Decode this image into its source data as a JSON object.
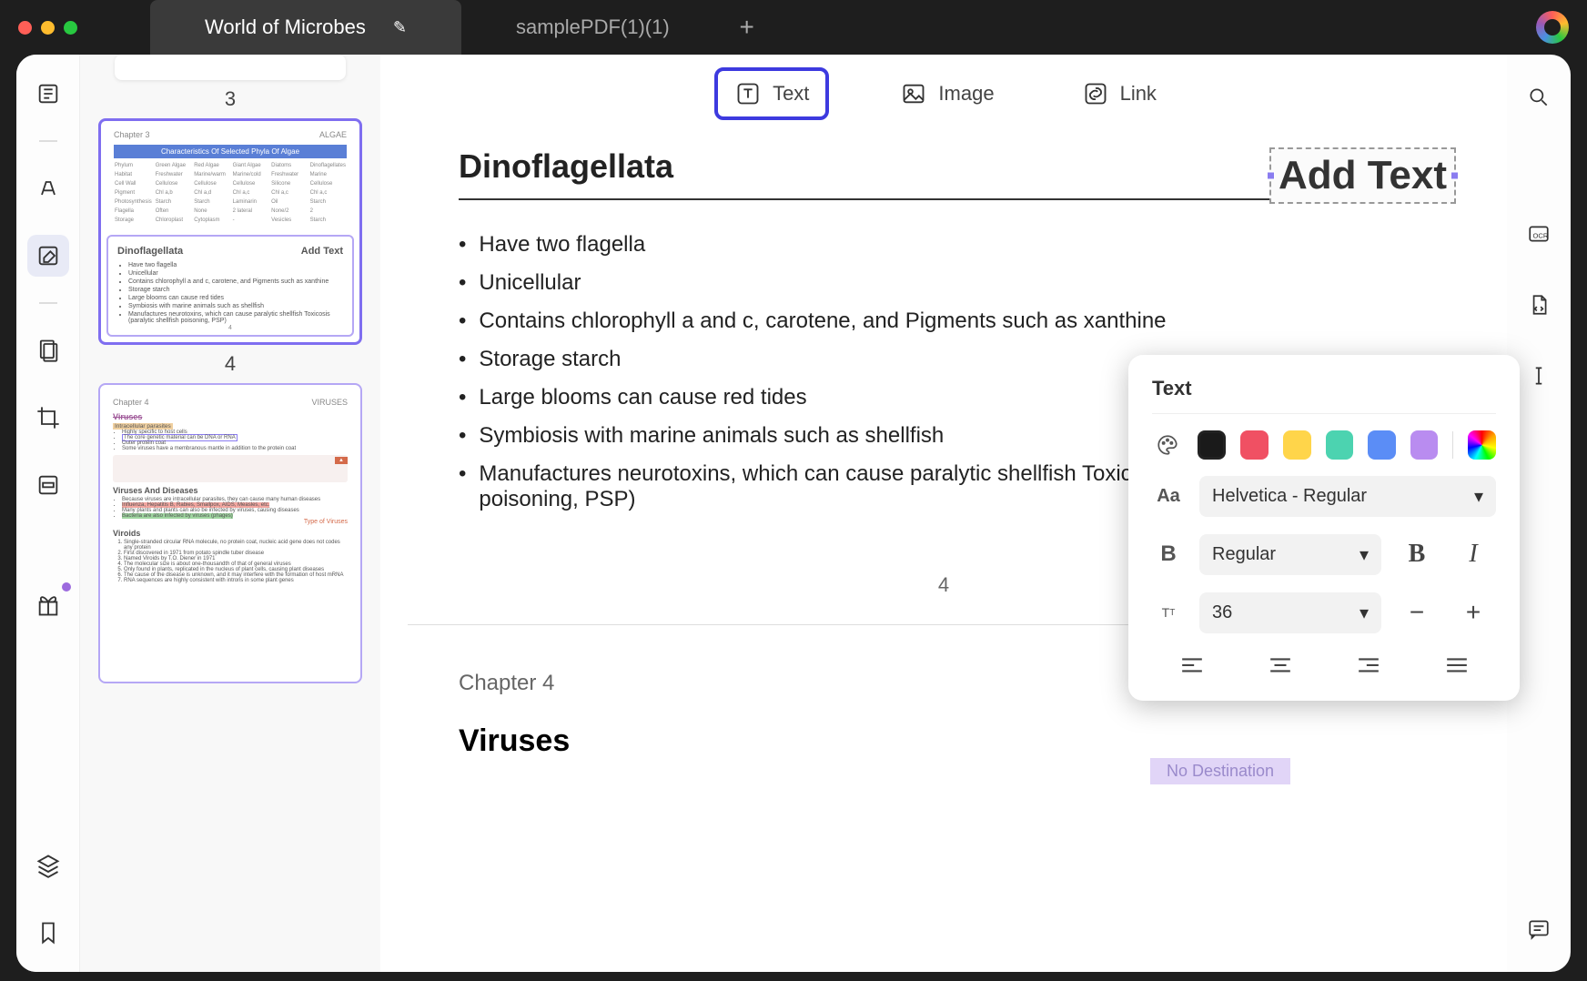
{
  "tabs": {
    "active": "World of Microbes",
    "inactive": "samplePDF(1)(1)"
  },
  "toolbar": {
    "text": "Text",
    "image": "Image",
    "link": "Link"
  },
  "thumbs": {
    "p3": "3",
    "p4": "4",
    "page4": {
      "chapter": "Chapter 3",
      "tag": "ALGAE",
      "band": "Characteristics Of Selected Phyla Of Algae",
      "title": "Dinoflagellata",
      "addtext": "Add Text",
      "pageno": "4",
      "items": [
        "Have two flagella",
        "Unicellular",
        "Contains chlorophyll a and c, carotene, and Pigments such as xanthine",
        "Storage starch",
        "Large blooms can cause red tides",
        "Symbiosis with marine animals such as shellfish",
        "Manufactures neurotoxins, which can cause paralytic shellfish Toxicosis (paralytic shellfish poisoning, PSP)"
      ]
    },
    "page5": {
      "chapter": "Chapter 4",
      "tag": "VIRUSES",
      "h_viruses": "Viruses",
      "h_vd": "Viruses And Diseases",
      "h_vr": "Viroids",
      "intracellular": "Intracellular parasites",
      "lines1": [
        "Highly specific to host cells",
        "The core genetic material can be DNA or RNA",
        "Outer protein coat",
        "Some viruses have a membranous mantle in addition to the protein coat"
      ],
      "vd": [
        "Because viruses are intracellular parasites, they can cause many human diseases",
        "Influenza, Hepatitis B, Rabies, Smallpox, AIDS, Measles, etc.",
        "Many plants and plants can also be infected by viruses, causing diseases",
        "Bacteria are also infected by viruses (phages)"
      ],
      "vr": [
        "Single-stranded circular RNA molecule, no protein coat, nucleic acid gene does not codes any protein",
        "First discovered in 1971 from potato spindle tuber disease",
        "Named Viroids by T.O. Diener in 1971",
        "The molecular size is about one-thousandth of that of general viruses",
        "Only found in plants, replicated in the nucleus of plant cells, causing plant diseases",
        "The cause of the disease is unknown, and it may interfere with the formation of host mRNA",
        "RNA sequences are highly consistent with introns in some plant genes"
      ],
      "tov": "Type of Viruses"
    }
  },
  "page": {
    "heading": "Dinoflagellata",
    "addtext": "Add Text",
    "items": [
      "Have two flagella",
      "Unicellular",
      "Contains chlorophyll a and c, carotene, and Pigments such as xanthine",
      "Storage starch",
      "Large blooms can cause red tides",
      "Symbiosis with marine animals such as shellfish",
      "Manufactures neurotoxins, which can cause paralytic shellfish Toxicosis (paralytic shellfish poisoning, PSP)"
    ],
    "pageno": "4",
    "next_chapter": "Chapter 4",
    "next_tag": "VIRUSES",
    "next_h": "Viruses",
    "nod": "No Destination"
  },
  "popover": {
    "title": "Text",
    "colors": [
      "#1a1a1a",
      "#f05063",
      "#ffd54a",
      "#4cd3b0",
      "#5b8df6",
      "#b98cf0"
    ],
    "font": "Helvetica - Regular",
    "weight": "Regular",
    "size": "36"
  }
}
